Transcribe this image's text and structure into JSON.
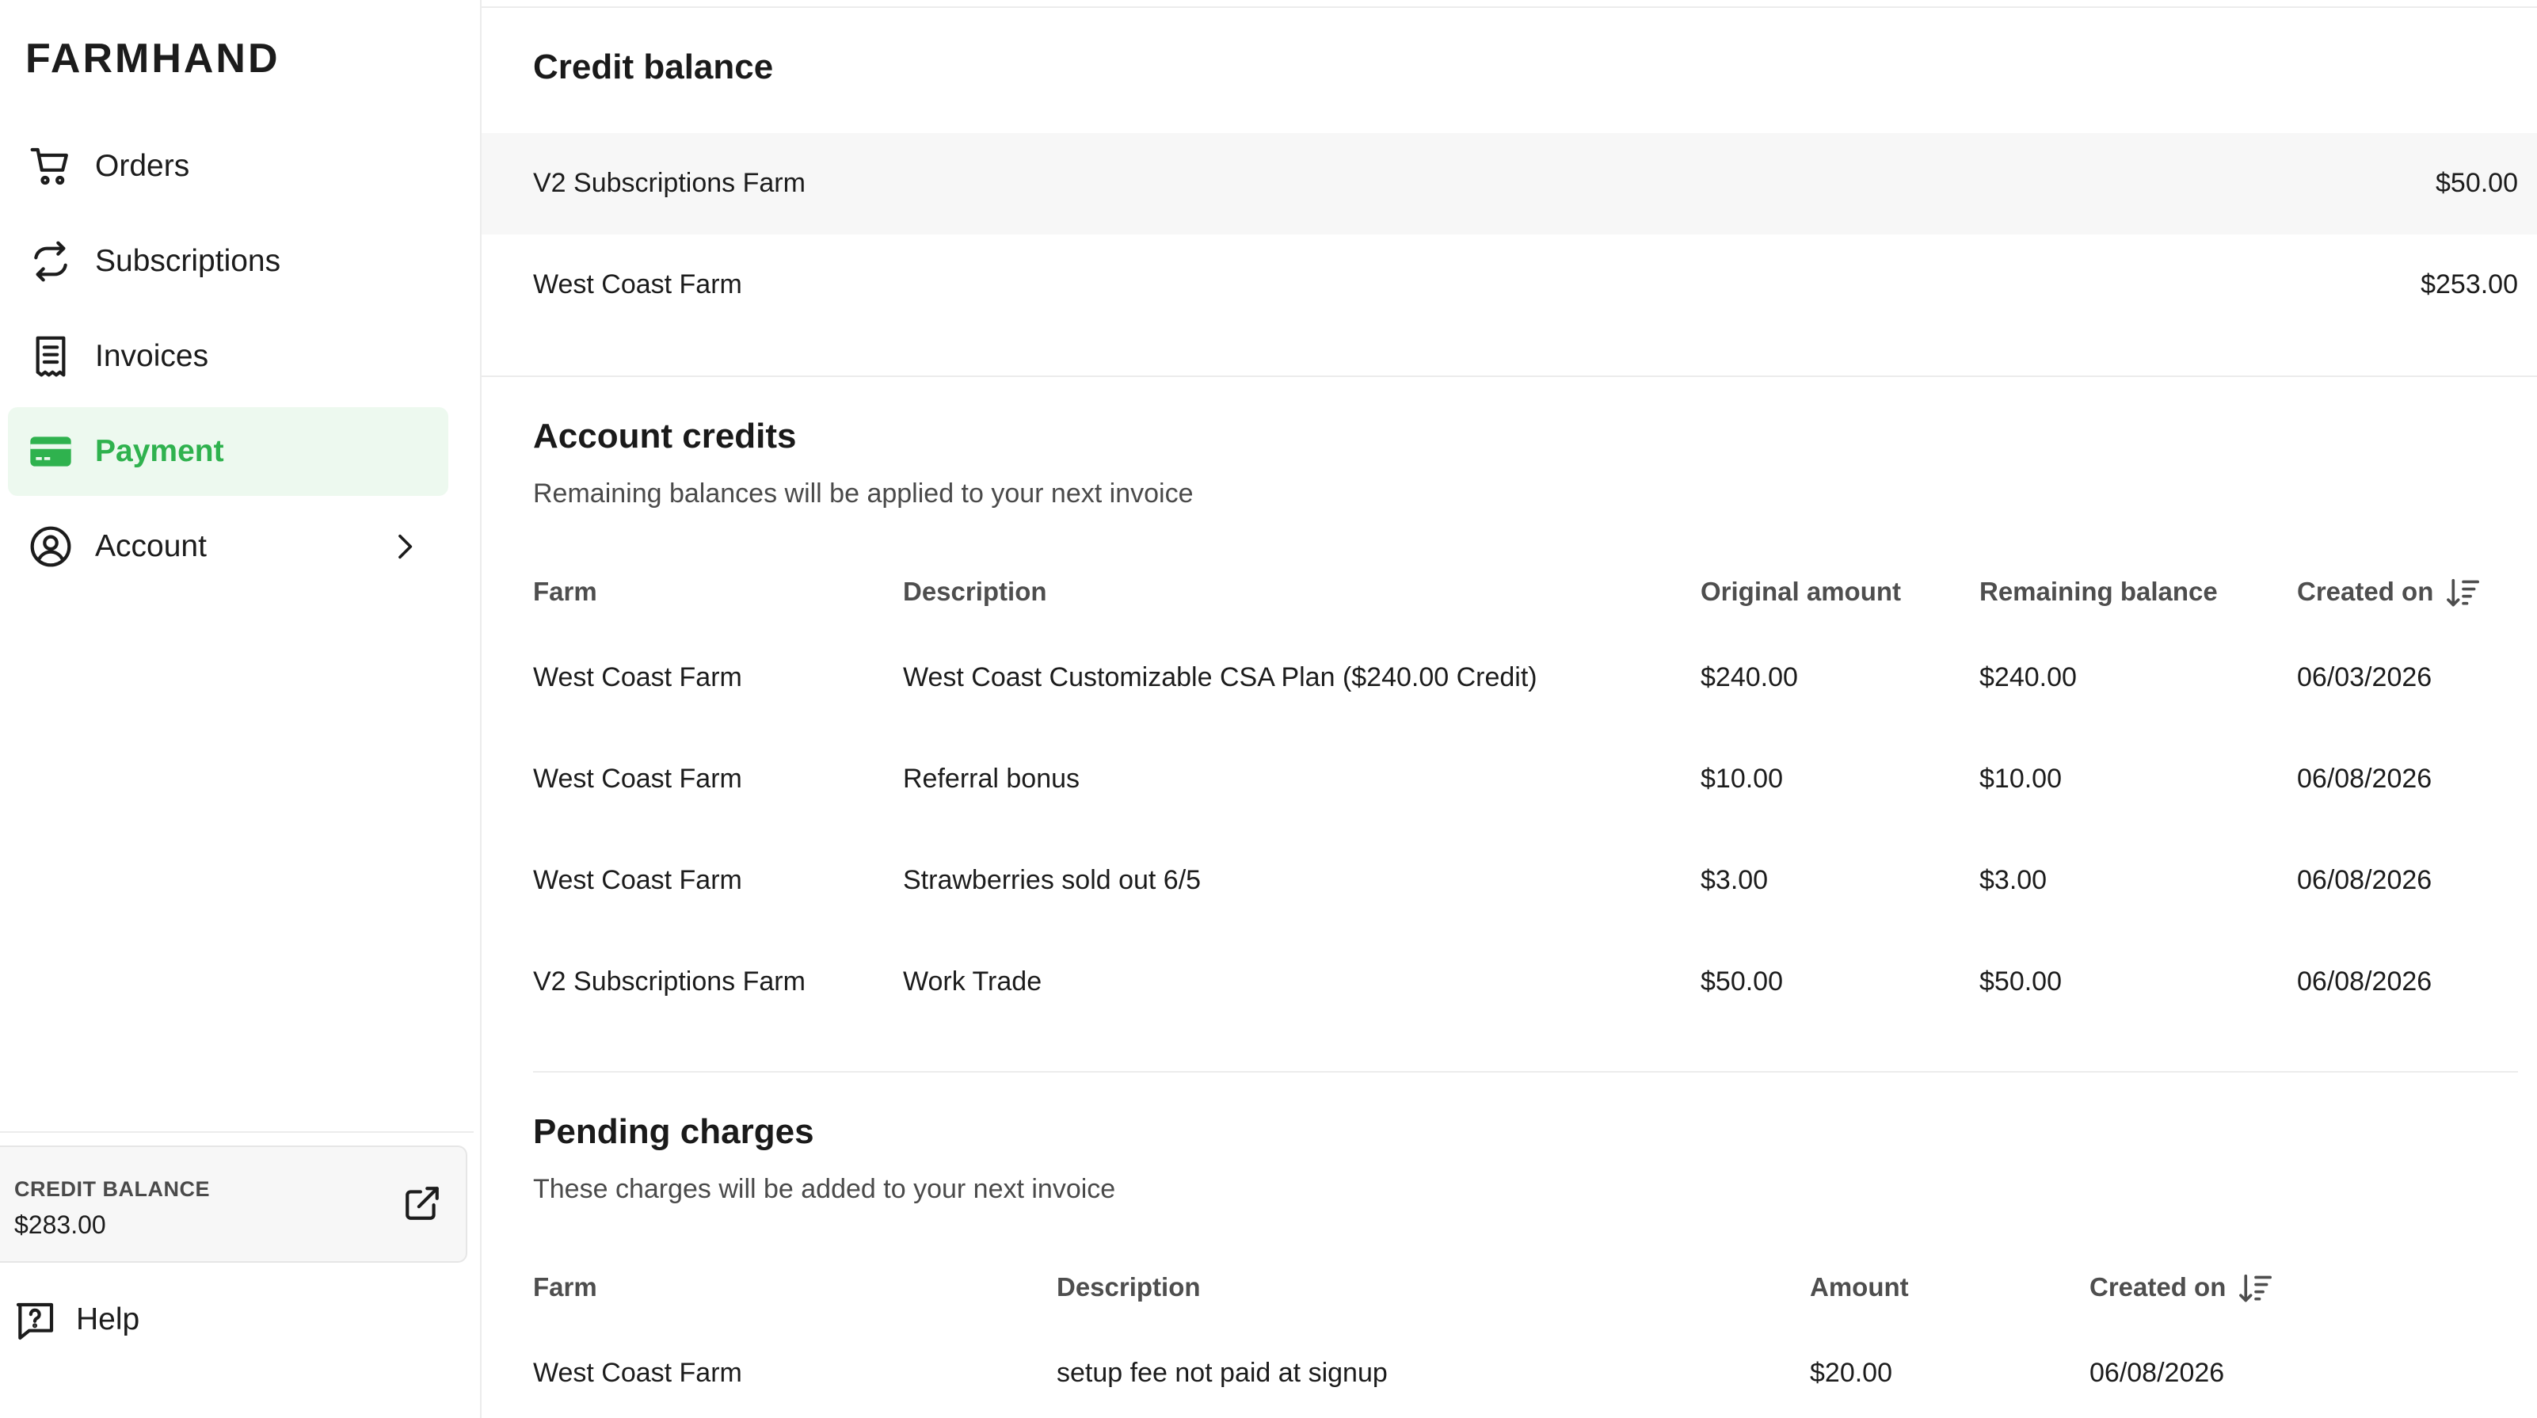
{
  "app": {
    "logo": "FARMHAND"
  },
  "sidebar": {
    "items": [
      {
        "label": "Orders",
        "icon": "cart-icon"
      },
      {
        "label": "Subscriptions",
        "icon": "repeat-icon"
      },
      {
        "label": "Invoices",
        "icon": "receipt-icon"
      },
      {
        "label": "Payment",
        "icon": "credit-card-icon",
        "active": true
      },
      {
        "label": "Account",
        "icon": "user-circle-icon"
      }
    ],
    "credit_balance": {
      "label": "CREDIT BALANCE",
      "value": "$283.00"
    },
    "help": {
      "label": "Help"
    }
  },
  "credit_balance": {
    "title": "Credit balance",
    "rows": [
      {
        "farm": "V2 Subscriptions Farm",
        "amount": "$50.00"
      },
      {
        "farm": "West Coast Farm",
        "amount": "$253.00"
      }
    ]
  },
  "account_credits": {
    "title": "Account credits",
    "subtitle": "Remaining balances will be applied to your next invoice",
    "headers": {
      "farm": "Farm",
      "description": "Description",
      "original": "Original amount",
      "remaining": "Remaining balance",
      "created": "Created on"
    },
    "rows": [
      {
        "farm": "West Coast Farm",
        "description": "West Coast Customizable CSA Plan ($240.00 Credit)",
        "original": "$240.00",
        "remaining": "$240.00",
        "created": "06/03/2026"
      },
      {
        "farm": "West Coast Farm",
        "description": "Referral bonus",
        "original": "$10.00",
        "remaining": "$10.00",
        "created": "06/08/2026"
      },
      {
        "farm": "West Coast Farm",
        "description": "Strawberries sold out 6/5",
        "original": "$3.00",
        "remaining": "$3.00",
        "created": "06/08/2026"
      },
      {
        "farm": "V2 Subscriptions Farm",
        "description": "Work Trade",
        "original": "$50.00",
        "remaining": "$50.00",
        "created": "06/08/2026"
      }
    ]
  },
  "pending_charges": {
    "title": "Pending charges",
    "subtitle": "These charges will be added to your next invoice",
    "headers": {
      "farm": "Farm",
      "description": "Description",
      "amount": "Amount",
      "created": "Created on"
    },
    "rows": [
      {
        "farm": "West Coast Farm",
        "description": "setup fee not paid at signup",
        "amount": "$20.00",
        "created": "06/08/2026"
      }
    ]
  },
  "colors": {
    "accent": "#2fb24e",
    "active_bg": "#edf9ef",
    "stripe": "#f7f7f7"
  }
}
